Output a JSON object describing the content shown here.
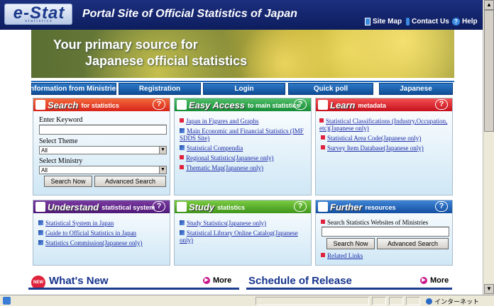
{
  "header": {
    "logo": "e-Stat",
    "logo_sub": "statistics",
    "title": "Portal Site of Official Statistics of Japan",
    "links": [
      {
        "label": "Site Map",
        "icon": "book-icon"
      },
      {
        "label": "Contact Us",
        "icon": "person-icon"
      },
      {
        "label": "Help",
        "icon": "help-icon"
      }
    ]
  },
  "banner": {
    "line1": "Your primary source for",
    "line2": "Japanese official statistics"
  },
  "nav": [
    "Information from Ministries",
    "Registration",
    "Login",
    "Quick poll",
    "Japanese"
  ],
  "search": {
    "title": "Search",
    "subtitle": "for statistics",
    "keyword_label": "Enter Keyword",
    "keyword_value": "",
    "theme_label": "Select Theme",
    "theme_value": "All",
    "ministry_label": "Select Ministry",
    "ministry_value": "All",
    "search_now": "Search Now",
    "advanced": "Advanced Search"
  },
  "easy": {
    "title": "Easy Access",
    "subtitle": "to main statistics",
    "links": [
      "Japan in Figures and Graphs",
      "Main Economic and Financial Statistics (IMF SDDS Site)",
      "Statistical Compendia",
      "Regional Statistics(Japanese only)",
      "Thematic Map(Japanese only)"
    ]
  },
  "learn": {
    "title": "Learn",
    "subtitle": "metadata",
    "links": [
      "Statistical Classifications (Industry,Occupation, etc)(Japanese only)",
      "Statistical Area Code(Japanese only)",
      "Survey Item Database(Japanese only)"
    ]
  },
  "understand": {
    "title": "Understand",
    "subtitle": "statistical system",
    "links": [
      "Statistical System in Japan",
      "Guide to Official Statistics in Japan",
      "Statistics Commission(Japanese only)"
    ]
  },
  "study": {
    "title": "Study",
    "subtitle": "statistics",
    "links": [
      "Study Statistics(Japanese only)",
      "Statistical Library Online Catalog(Japanese only)"
    ]
  },
  "further": {
    "title": "Further",
    "subtitle": "resources",
    "search_label": "Search Statistics Websites of Ministries",
    "search_value": "",
    "search_now": "Search Now",
    "advanced": "Advanced Search",
    "related": "Related Links"
  },
  "whats_new": {
    "badge": "NEW",
    "title": "What's New",
    "more": "More"
  },
  "schedule": {
    "title": "Schedule of Release",
    "more": "More"
  },
  "status": {
    "zone": "インターネット"
  },
  "colors": {
    "header": "#1c2f7e",
    "nav": "#1e6abf",
    "link": "#1a2aa8",
    "section_title": "#17348e"
  }
}
